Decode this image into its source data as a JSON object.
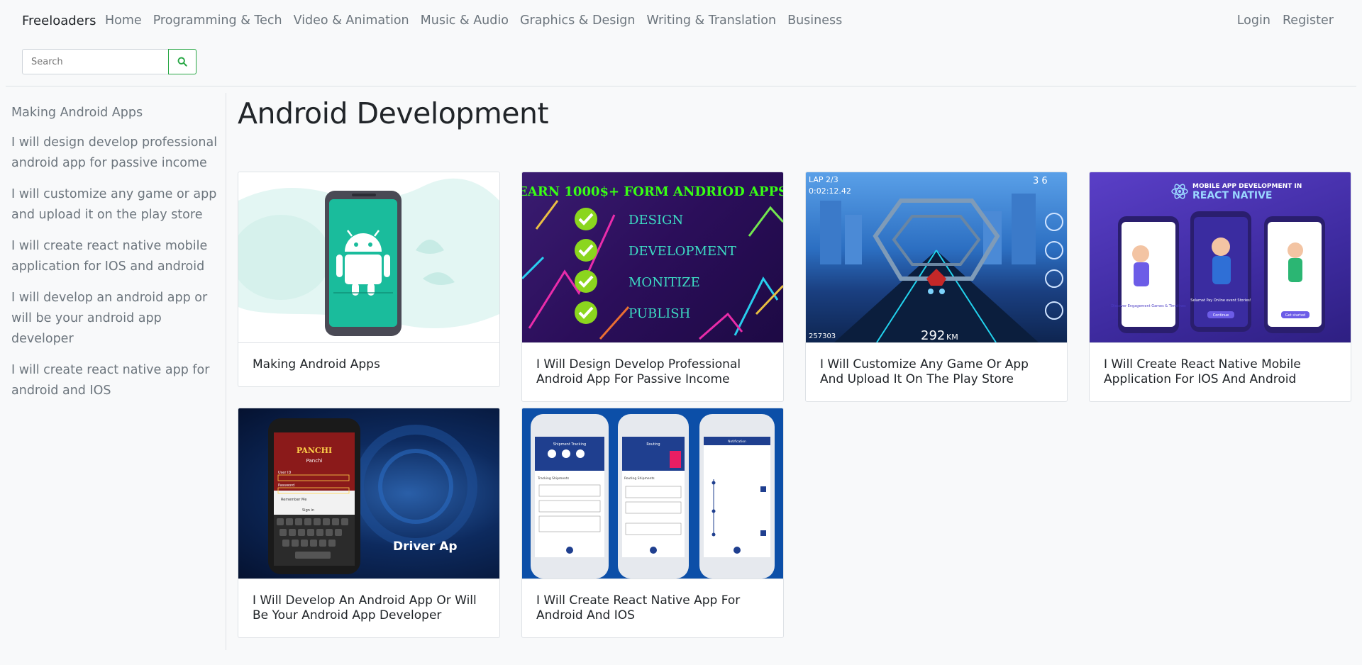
{
  "brand": "Freeloaders",
  "nav": {
    "links": [
      "Home",
      "Programming & Tech",
      "Video & Animation",
      "Music & Audio",
      "Graphics & Design",
      "Writing & Translation",
      "Business"
    ],
    "login": "Login",
    "register": "Register"
  },
  "search": {
    "placeholder": "Search",
    "icon": "search-icon",
    "accent": "#28a745"
  },
  "sidebar": {
    "items": [
      "Making Android Apps",
      "I will design develop professional android app for passive income",
      "I will customize any game or app and upload it on the play store",
      "I will create react native mobile application for IOS and android",
      "I will develop an android app or will be your android app developer",
      "I will create react native app for android and IOS"
    ]
  },
  "page_title": "Android Development",
  "cards": [
    {
      "title": "Making Android Apps",
      "image": {
        "icon": "android-icon"
      }
    },
    {
      "title": "I Will Design Develop Professional Android App For Passive Income",
      "image": {
        "headline": "EARN 1000$+ FORM ANDRIOD APPS",
        "checklist": [
          "DESIGN",
          "DEVELOPMENT",
          "MONITIZE",
          "PUBLISH"
        ]
      }
    },
    {
      "title": "I Will Customize Any Game Or App And Upload It On The Play Store",
      "image": {
        "top_left": "LAP 2/3",
        "time": "0:02:12.42",
        "top_right": "3 6",
        "bottom_left": "257303",
        "speed": "292",
        "speed_unit": "KM"
      }
    },
    {
      "title": "I Will Create React Native Mobile Application For IOS And Android",
      "image": {
        "line1": "MOBILE APP DEVELOPMENT IN",
        "line2": "REACT NATIVE",
        "phone1_caption": "Discover Engagement Games & Timelines",
        "phone2_caption": "Selamat Pay Online event Stories!",
        "phone2_button": "Continue",
        "phone3_button": "Get started"
      }
    },
    {
      "title": "I Will Develop An Android App Or Will Be Your Android App Developer",
      "image": {
        "text": "Driver Ap",
        "app_name": "PANCHI",
        "app_sub": "Panchi",
        "field_user": "User ID",
        "field_password": "Password",
        "remember": "Remember Me",
        "button": "Sign in"
      }
    },
    {
      "title": "I Will Create React Native App For Android And IOS",
      "image": {
        "screen1_title": "Shipment Tracking",
        "screen2_title": "Routing",
        "screen3_title": "Notification",
        "screen1_section": "Tracking Shipments",
        "screen2_section": "Routing Shipments"
      }
    }
  ]
}
